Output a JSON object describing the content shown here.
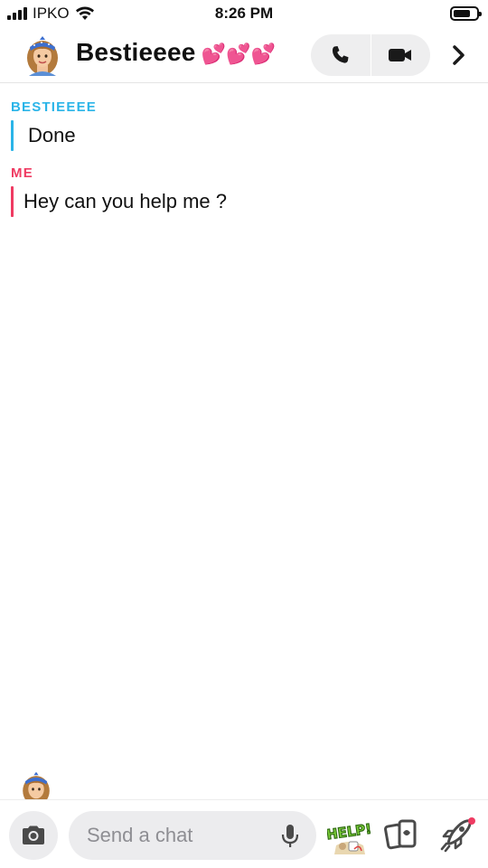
{
  "status_bar": {
    "carrier": "IPKO",
    "time": "8:26 PM",
    "icons": [
      "signal-icon",
      "wifi-icon",
      "battery-icon"
    ]
  },
  "header": {
    "title": "Bestieeee",
    "title_emoji": "💕💕💕",
    "icons": [
      "avatar",
      "phone-icon",
      "video-icon",
      "chevron-right-icon"
    ]
  },
  "messages": [
    {
      "sender": "BESTIEEEE",
      "text": "Done",
      "from": "friend",
      "color": "#2ab4e8"
    },
    {
      "sender": "ME",
      "text": "Hey can you help me ?",
      "from": "me",
      "color": "#ef3b62"
    }
  ],
  "composer": {
    "placeholder": "Send a chat",
    "sticker_text": "HELP!",
    "icons": [
      "camera-icon",
      "microphone-icon",
      "help-sticker",
      "cards-icon",
      "rocket-icon"
    ]
  },
  "colors": {
    "friend_accent": "#2ab4e8",
    "me_accent": "#ef3b62",
    "pill_background": "#ececee",
    "hearts": "#ff4fb0"
  }
}
